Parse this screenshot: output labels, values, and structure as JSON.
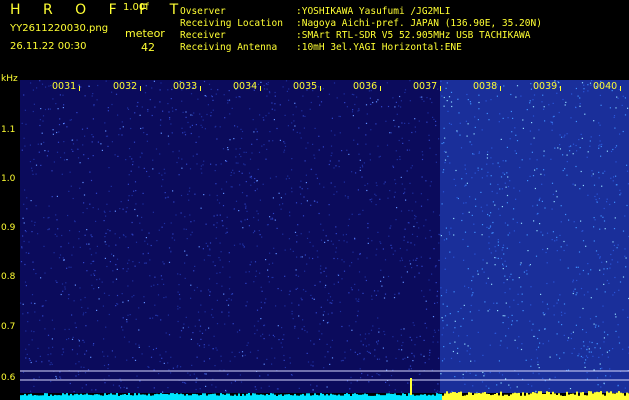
{
  "header": {
    "app_title": "H R O F F T",
    "version": "1.00f",
    "filename": "YY2611220030.png",
    "datetime": "26.11.22 00:30",
    "meteor_label": "meteor",
    "meteor_count": "42"
  },
  "info": [
    {
      "key": "Ovserver",
      "value": ":YOSHIKAWA Yasufumi /JG2MLI"
    },
    {
      "key": "Receiving Location",
      "value": ":Nagoya Aichi-pref. JAPAN (136.90E, 35.20N)"
    },
    {
      "key": "Receiver",
      "value": ":SMArt RTL-SDR V5 52.905MHz USB TACHIKAWA"
    },
    {
      "key": "Receiving Antenna",
      "value": ":10mH 3el.YAGI Horizontal:ENE"
    }
  ],
  "y_axis": {
    "unit": "kHz",
    "ticks": [
      "1.1",
      "1.0",
      "0.9",
      "0.8",
      "0.7",
      "0.6"
    ]
  },
  "time_axis": {
    "labels": [
      "0031",
      "0032",
      "0033",
      "0034",
      "0035",
      "0036",
      "0037",
      "0038",
      "0039",
      "0040"
    ]
  },
  "colors": {
    "text": "#ffff33",
    "background": "#000000",
    "noise_low": "#0a0a6a",
    "noise_high": "#2f7bff",
    "spectrum_trace": "#00e5ff"
  }
}
